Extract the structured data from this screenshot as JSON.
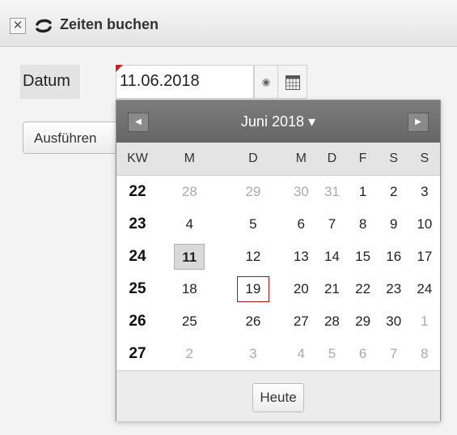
{
  "window": {
    "title": "Zeiten buchen",
    "close_icon": "close-icon",
    "sync_icon": "sync-icon"
  },
  "form": {
    "date_label": "Datum",
    "date_value": "11.06.2018",
    "clear_icon": "clear-icon",
    "calendar_icon": "calendar-icon",
    "run_button": "Ausführen"
  },
  "datepicker": {
    "month_label": "Juni 2018",
    "dropdown_glyph": "▾",
    "prev_glyph": "◀",
    "next_glyph": "▶",
    "headers": [
      "KW",
      "M",
      "D",
      "M",
      "D",
      "F",
      "S",
      "S"
    ],
    "weeks": [
      {
        "kw": "22",
        "days": [
          "28",
          "29",
          "30",
          "31",
          "1",
          "2",
          "3"
        ],
        "other": [
          0,
          1,
          2,
          3
        ]
      },
      {
        "kw": "23",
        "days": [
          "4",
          "5",
          "6",
          "7",
          "8",
          "9",
          "10"
        ],
        "other": []
      },
      {
        "kw": "24",
        "days": [
          "11",
          "12",
          "13",
          "14",
          "15",
          "16",
          "17"
        ],
        "other": [],
        "selected": 0
      },
      {
        "kw": "25",
        "days": [
          "18",
          "19",
          "20",
          "21",
          "22",
          "23",
          "24"
        ],
        "other": [],
        "today": 1
      },
      {
        "kw": "26",
        "days": [
          "25",
          "26",
          "27",
          "28",
          "29",
          "30",
          "1"
        ],
        "other": [
          6
        ]
      },
      {
        "kw": "27",
        "days": [
          "2",
          "3",
          "4",
          "5",
          "6",
          "7",
          "8"
        ],
        "other": [
          0,
          1,
          2,
          3,
          4,
          5,
          6
        ]
      }
    ],
    "today_button": "Heute"
  },
  "colors": {
    "header_bg": "#6e6e6e",
    "today_border": "#a01818",
    "invalid_marker": "#cc2020"
  }
}
